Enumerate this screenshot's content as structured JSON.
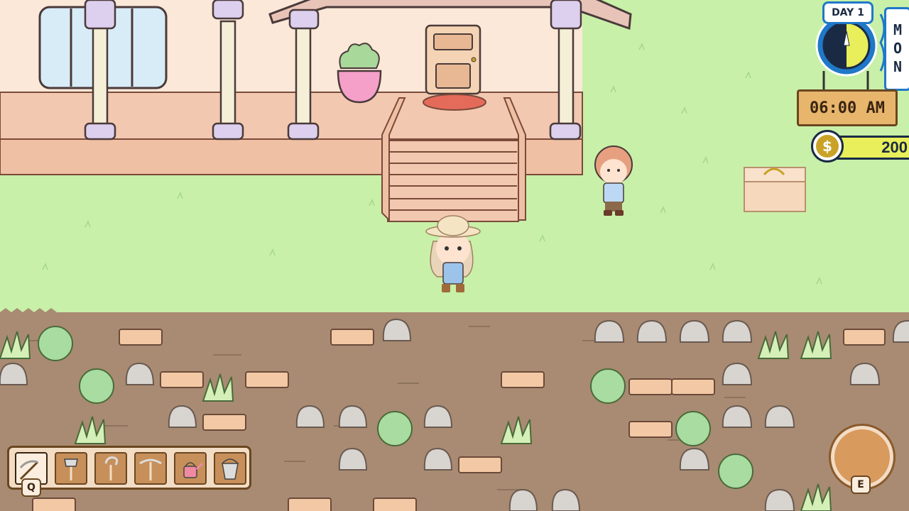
{
  "hud": {
    "day_label": "DAY 1",
    "weekday": "MON",
    "time": "06:00 AM",
    "money": "200",
    "currency_symbol": "$"
  },
  "toolbar": {
    "tools": [
      {
        "name": "scythe",
        "selected": true
      },
      {
        "name": "axe",
        "selected": false
      },
      {
        "name": "hoe",
        "selected": false
      },
      {
        "name": "pickaxe",
        "selected": false
      },
      {
        "name": "watering-can",
        "selected": false
      },
      {
        "name": "bucket",
        "selected": false
      }
    ],
    "key_hint": "Q"
  },
  "action": {
    "key_hint": "E"
  },
  "colors": {
    "grass": "#c8f0a8",
    "soil": "#a88b72",
    "house_wall": "#fbe8d8",
    "porch": "#f3c8b0",
    "hud_blue": "#1f78c8",
    "money_yellow": "#e8ef5a",
    "wood_sign": "#e7b66c"
  }
}
